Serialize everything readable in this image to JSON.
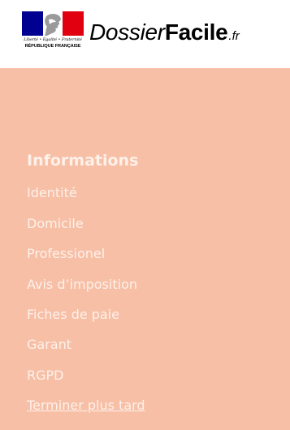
{
  "header": {
    "republique_devise": "Liberté • Égalité • Fraternité",
    "republique_name": "RÉPUBLIQUE FRANÇAISE",
    "brand_part1": "Dossier",
    "brand_part2": "Facile",
    "brand_tld": ".fr",
    "flag_colors": {
      "blue": "#000091",
      "white": "#ffffff",
      "red": "#e1000f"
    }
  },
  "menu": {
    "background": "#f7bfa6",
    "title": "Informations",
    "items": [
      {
        "label": "Identité"
      },
      {
        "label": "Domicile"
      },
      {
        "label": "Professionel"
      },
      {
        "label": "Avis d’imposition"
      },
      {
        "label": "Fiches de paie"
      },
      {
        "label": "Garant"
      },
      {
        "label": "RGPD"
      }
    ],
    "later_link": "Terminer plus tard"
  }
}
